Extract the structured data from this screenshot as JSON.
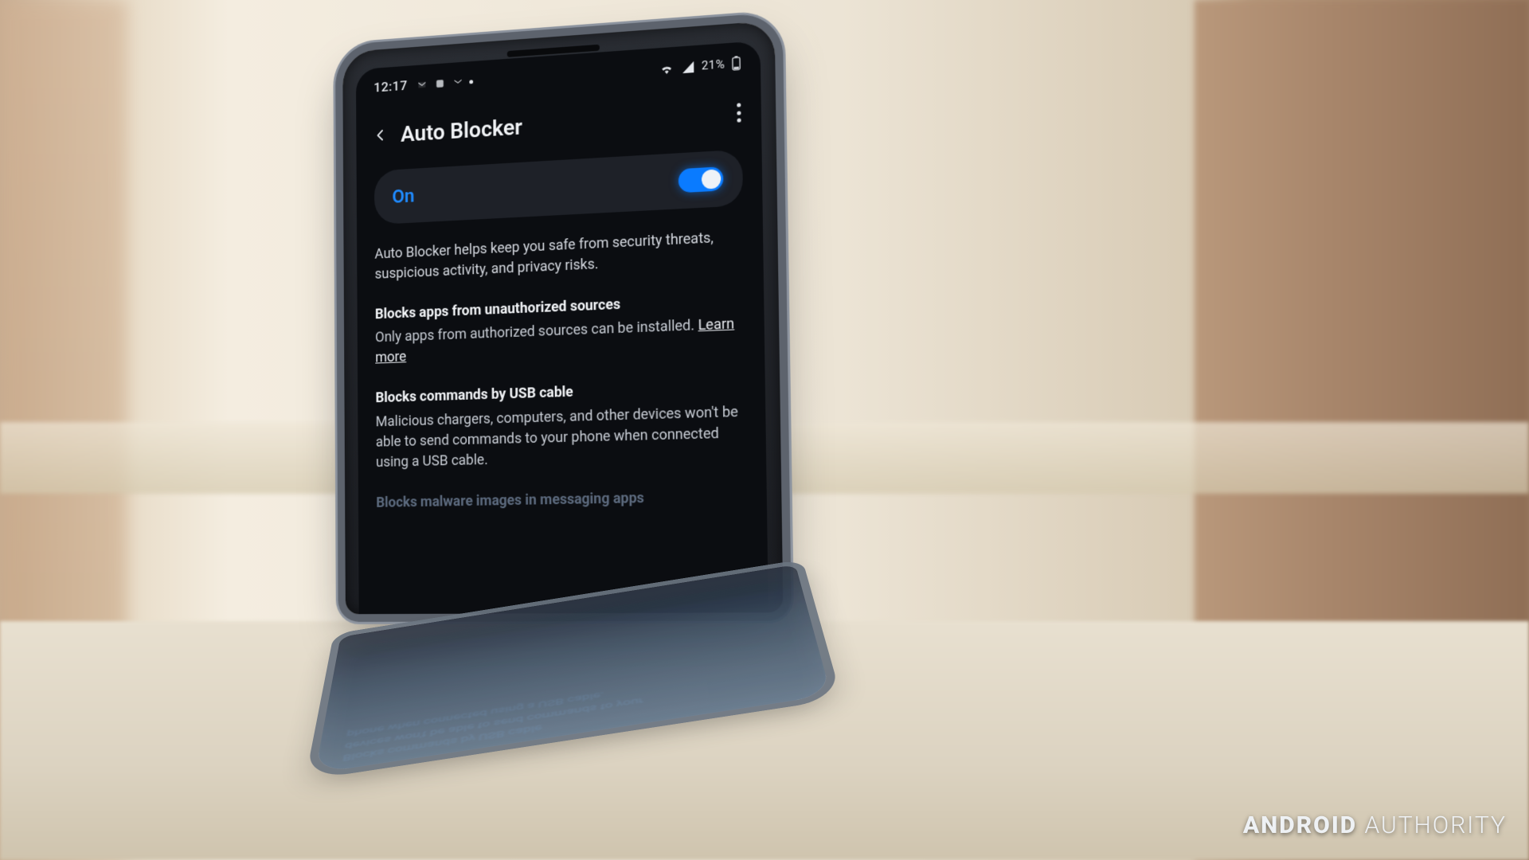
{
  "statusbar": {
    "time": "12:17",
    "notif_icons": [
      "gmail-icon",
      "app-icon",
      "gmail-icon",
      "more-dot"
    ],
    "wifi": true,
    "signal": true,
    "battery_pct": "21%"
  },
  "header": {
    "title": "Auto Blocker"
  },
  "toggle": {
    "state_label": "On",
    "value": true
  },
  "intro": "Auto Blocker helps keep you safe from security threats, suspicious activity, and privacy risks.",
  "sections": [
    {
      "title": "Blocks apps from unauthorized sources",
      "sub": "Only apps from authorized sources can be installed.",
      "learn_more": "Learn more"
    },
    {
      "title": "Blocks commands by USB cable",
      "sub": "Malicious chargers, computers, and other devices won't be able to send commands to your phone when connected using a USB cable."
    },
    {
      "title_cutoff": "Blocks malware images in messaging apps"
    }
  ],
  "watermark": {
    "brand_bold": "ANDROID",
    "brand_light": "AUTHORITY"
  },
  "colors": {
    "accent": "#0a7bff",
    "screen_bg": "#0b0d11",
    "text": "#e9ecf1"
  }
}
